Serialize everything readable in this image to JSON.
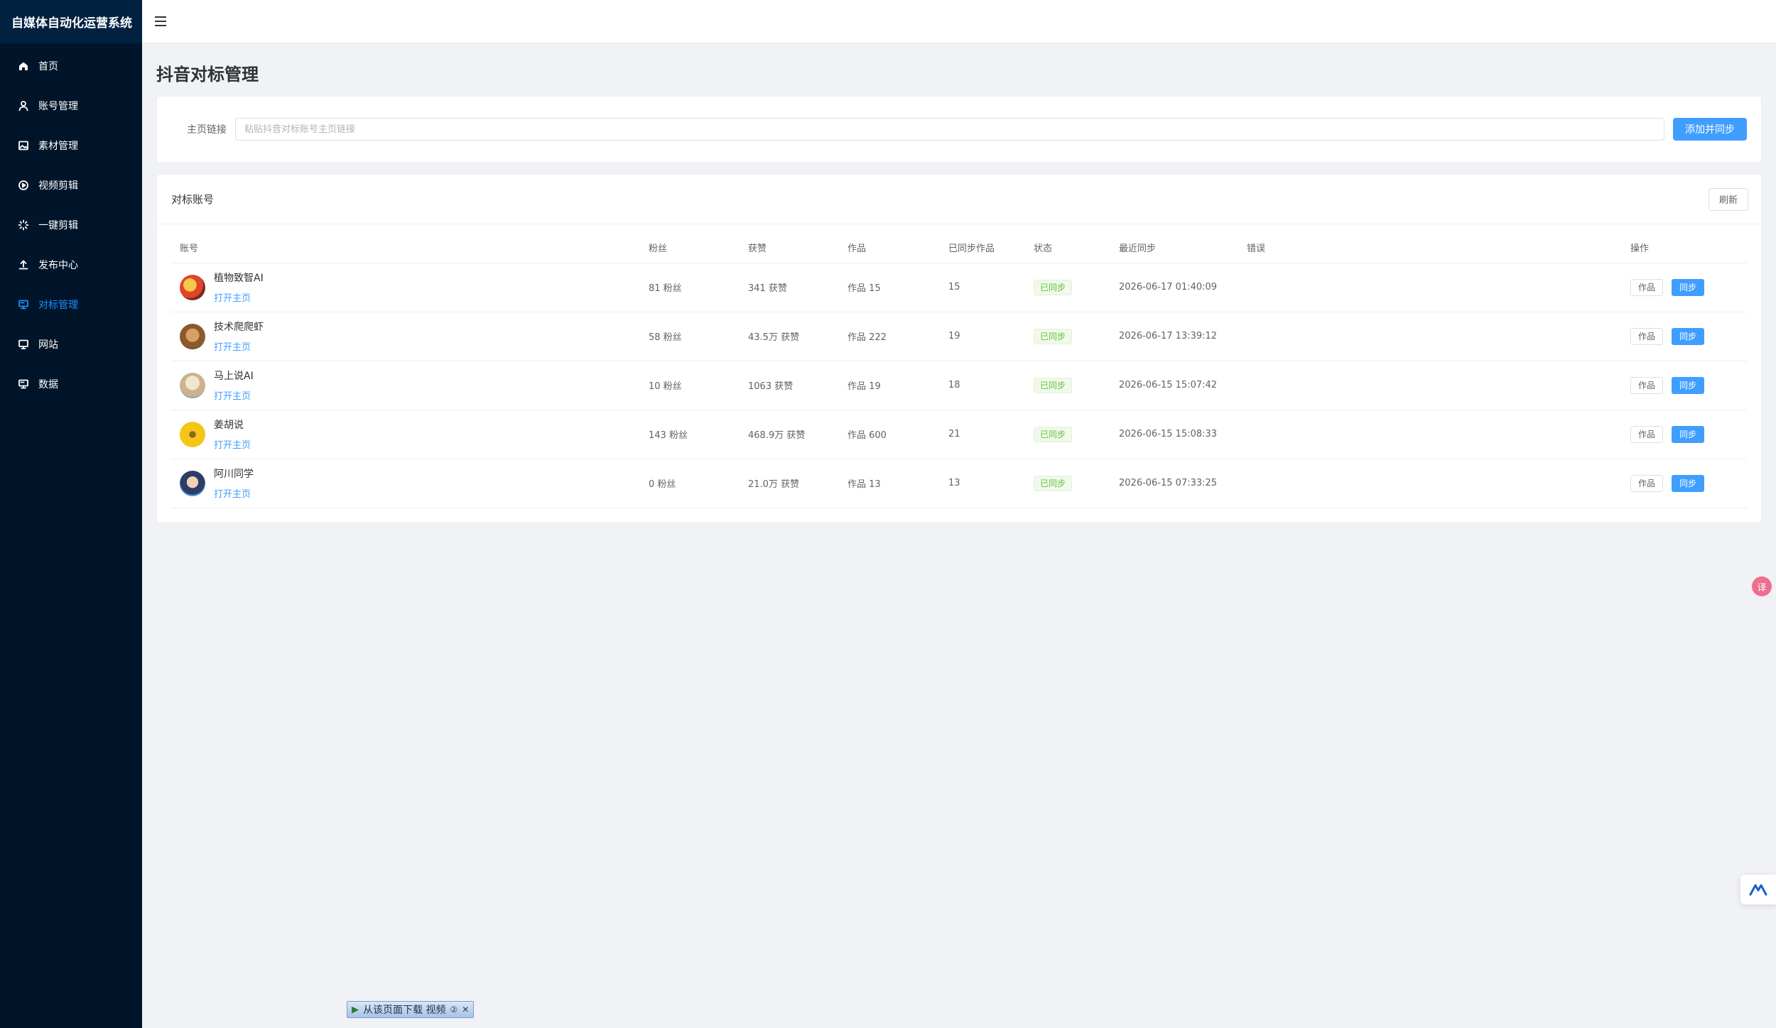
{
  "app": {
    "title": "自媒体自动化运营系统"
  },
  "sidebar": {
    "items": [
      {
        "label": "首页",
        "icon": "home-icon"
      },
      {
        "label": "账号管理",
        "icon": "user-icon"
      },
      {
        "label": "素材管理",
        "icon": "image-icon"
      },
      {
        "label": "视频剪辑",
        "icon": "play-circle-icon"
      },
      {
        "label": "一键剪辑",
        "icon": "magic-icon"
      },
      {
        "label": "发布中心",
        "icon": "upload-icon"
      },
      {
        "label": "对标管理",
        "icon": "target-icon",
        "active": true
      },
      {
        "label": "网站",
        "icon": "monitor-icon"
      },
      {
        "label": "数据",
        "icon": "data-icon"
      }
    ]
  },
  "page": {
    "title": "抖音对标管理"
  },
  "form": {
    "label": "主页链接",
    "placeholder": "粘贴抖音对标账号主页链接",
    "submit_label": "添加并同步"
  },
  "list": {
    "title": "对标账号",
    "refresh_label": "刷新",
    "columns": [
      "账号",
      "粉丝",
      "获赞",
      "作品",
      "已同步作品",
      "状态",
      "最近同步",
      "错误",
      "操作"
    ],
    "rows": [
      {
        "name": "植物致智AI",
        "link": "打开主页",
        "fans": "81 粉丝",
        "likes": "341 获赞",
        "works": "作品 15",
        "synced": "15",
        "status": "已同步",
        "last_sync": "2026-06-17 01:40:09",
        "error": "",
        "btn_works": "作品",
        "btn_sync": "同步"
      },
      {
        "name": "技术爬爬虾",
        "link": "打开主页",
        "fans": "58 粉丝",
        "likes": "43.5万 获赞",
        "works": "作品 222",
        "synced": "19",
        "status": "已同步",
        "last_sync": "2026-06-17 13:39:12",
        "error": "",
        "btn_works": "作品",
        "btn_sync": "同步"
      },
      {
        "name": "马上说AI",
        "link": "打开主页",
        "fans": "10 粉丝",
        "likes": "1063 获赞",
        "works": "作品 19",
        "synced": "18",
        "status": "已同步",
        "last_sync": "2026-06-15 15:07:42",
        "error": "",
        "btn_works": "作品",
        "btn_sync": "同步"
      },
      {
        "name": "姜胡说",
        "link": "打开主页",
        "fans": "143 粉丝",
        "likes": "468.9万 获赞",
        "works": "作品 600",
        "synced": "21",
        "status": "已同步",
        "last_sync": "2026-06-15 15:08:33",
        "error": "",
        "btn_works": "作品",
        "btn_sync": "同步"
      },
      {
        "name": "阿川同学",
        "link": "打开主页",
        "fans": "0 粉丝",
        "likes": "21.0万 获赞",
        "works": "作品 13",
        "synced": "13",
        "status": "已同步",
        "last_sync": "2026-06-15 07:33:25",
        "error": "",
        "btn_works": "作品",
        "btn_sync": "同步"
      }
    ]
  },
  "overlay": {
    "download_label": "从该页面下载 视频",
    "download_help": "②",
    "download_close": "✕",
    "translate_glyph": "译"
  },
  "colors": {
    "sidebar_bg": "#001529",
    "accent": "#409eff",
    "success": "#67c23a"
  }
}
